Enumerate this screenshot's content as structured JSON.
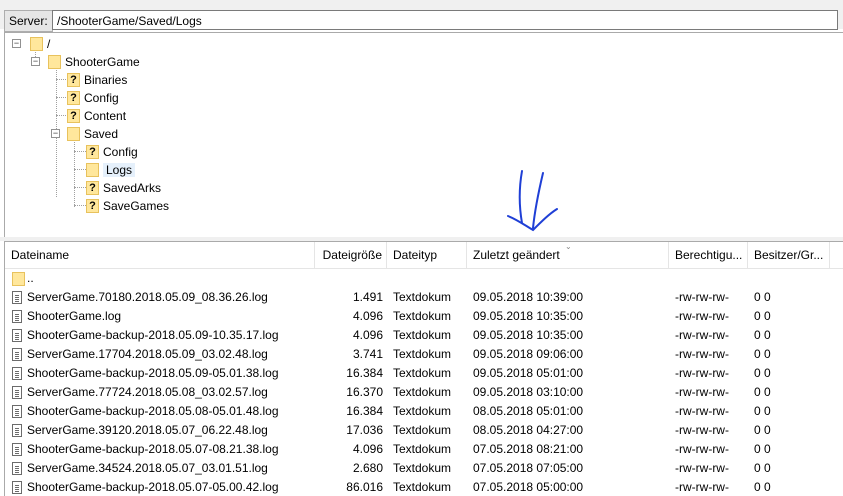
{
  "pathbar": {
    "server_label": "Server:",
    "path": "/ShooterGame/Saved/Logs"
  },
  "tree": {
    "root": {
      "label": "/"
    },
    "shootergame": {
      "label": "ShooterGame"
    },
    "binaries": {
      "label": "Binaries"
    },
    "config": {
      "label": "Config"
    },
    "content": {
      "label": "Content"
    },
    "saved": {
      "label": "Saved"
    },
    "saved_config": {
      "label": "Config"
    },
    "logs": {
      "label": "Logs"
    },
    "savedarks": {
      "label": "SavedArks"
    },
    "savegames": {
      "label": "SaveGames"
    }
  },
  "list": {
    "columns": [
      "Dateiname",
      "Dateigröße",
      "Dateityp",
      "Zuletzt geändert",
      "Berechtigu...",
      "Besitzer/Gr..."
    ],
    "parent_row": {
      "name": ".."
    },
    "rows": [
      {
        "name": "ServerGame.70180.2018.05.09_08.36.26.log",
        "size": "1.491",
        "type": "Textdokum",
        "modified": "09.05.2018 10:39:00",
        "perms": "-rw-rw-rw-",
        "owner": "0 0"
      },
      {
        "name": "ShooterGame.log",
        "size": "4.096",
        "type": "Textdokum",
        "modified": "09.05.2018 10:35:00",
        "perms": "-rw-rw-rw-",
        "owner": "0 0"
      },
      {
        "name": "ShooterGame-backup-2018.05.09-10.35.17.log",
        "size": "4.096",
        "type": "Textdokum",
        "modified": "09.05.2018 10:35:00",
        "perms": "-rw-rw-rw-",
        "owner": "0 0"
      },
      {
        "name": "ServerGame.17704.2018.05.09_03.02.48.log",
        "size": "3.741",
        "type": "Textdokum",
        "modified": "09.05.2018 09:06:00",
        "perms": "-rw-rw-rw-",
        "owner": "0 0"
      },
      {
        "name": "ShooterGame-backup-2018.05.09-05.01.38.log",
        "size": "16.384",
        "type": "Textdokum",
        "modified": "09.05.2018 05:01:00",
        "perms": "-rw-rw-rw-",
        "owner": "0 0"
      },
      {
        "name": "ServerGame.77724.2018.05.08_03.02.57.log",
        "size": "16.370",
        "type": "Textdokum",
        "modified": "09.05.2018 03:10:00",
        "perms": "-rw-rw-rw-",
        "owner": "0 0"
      },
      {
        "name": "ShooterGame-backup-2018.05.08-05.01.48.log",
        "size": "16.384",
        "type": "Textdokum",
        "modified": "08.05.2018 05:01:00",
        "perms": "-rw-rw-rw-",
        "owner": "0 0"
      },
      {
        "name": "ServerGame.39120.2018.05.07_06.22.48.log",
        "size": "17.036",
        "type": "Textdokum",
        "modified": "08.05.2018 04:27:00",
        "perms": "-rw-rw-rw-",
        "owner": "0 0"
      },
      {
        "name": "ShooterGame-backup-2018.05.07-08.21.38.log",
        "size": "4.096",
        "type": "Textdokum",
        "modified": "07.05.2018 08:21:00",
        "perms": "-rw-rw-rw-",
        "owner": "0 0"
      },
      {
        "name": "ServerGame.34524.2018.05.07_03.01.51.log",
        "size": "2.680",
        "type": "Textdokum",
        "modified": "07.05.2018 07:05:00",
        "perms": "-rw-rw-rw-",
        "owner": "0 0"
      },
      {
        "name": "ShooterGame-backup-2018.05.07-05.00.42.log",
        "size": "86.016",
        "type": "Textdokum",
        "modified": "07.05.2018 05:00:00",
        "perms": "-rw-rw-rw-",
        "owner": "0 0"
      }
    ]
  },
  "colors": {
    "folder": "#ffe79c",
    "annotation": "#1f3fd6"
  }
}
